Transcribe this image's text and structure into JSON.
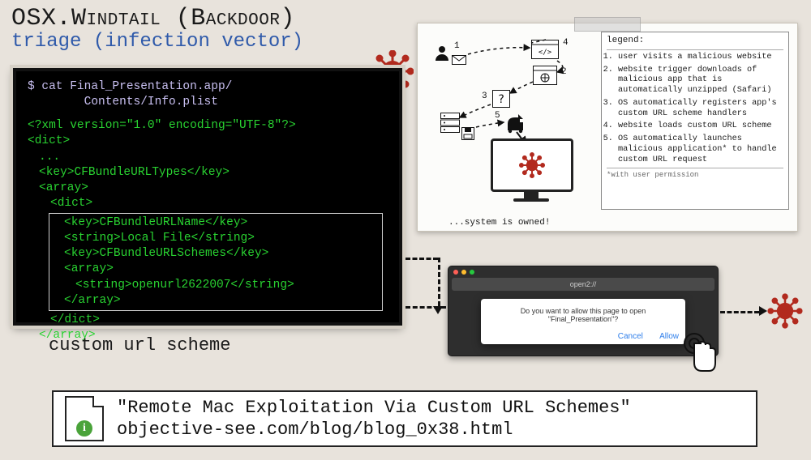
{
  "header": {
    "title": "OSX.Windtail (Backdoor)",
    "subtitle": "triage (infection vector)"
  },
  "terminal": {
    "prompt": "$ cat Final_Presentation.app/",
    "prompt_indent": "        Contents/Info.plist",
    "xml_decl": "<?xml version=\"1.0\" encoding=\"UTF-8\"?>",
    "dict_open": "<dict>",
    "ellipsis": "...",
    "key_urltypes": "<key>CFBundleURLTypes</key>",
    "array_open": "<array>",
    "dict2_open": "<dict>",
    "key_urlname": "<key>CFBundleURLName</key>",
    "str_localfile": "<string>Local File</string>",
    "key_urlschemes": "<key>CFBundleURLSchemes</key>",
    "array2_open": "<array>",
    "str_scheme": "<string>openurl2622007</string>",
    "array2_close": "</array>",
    "dict2_close": "</dict>",
    "array_close": "</array>",
    "caption": "custom url scheme"
  },
  "diagram": {
    "steps": {
      "s1": "1",
      "s2": "2",
      "s3": "3",
      "s4": "4",
      "s5": "5"
    },
    "legend_title": "legend:",
    "items": [
      "user visits a malicious website",
      "website trigger downloads of malicious app that is automatically unzipped (Safari)",
      "OS automatically registers app's custom URL scheme handlers",
      "website loads custom URL scheme",
      "OS automatically launches malicious application* to handle custom URL request"
    ],
    "note": "*with user permission",
    "owned": "...system is owned!"
  },
  "popup": {
    "url": "open2://",
    "message": "Do you want to allow this page to open \"Final_Presentation\"?",
    "cancel": "Cancel",
    "allow": "Allow"
  },
  "citation": {
    "title": "\"Remote Mac Exploitation Via Custom URL Schemes\"",
    "url": "objective-see.com/blog/blog_0x38.html",
    "info_glyph": "i"
  },
  "colors": {
    "virus": "#b22a1e"
  }
}
